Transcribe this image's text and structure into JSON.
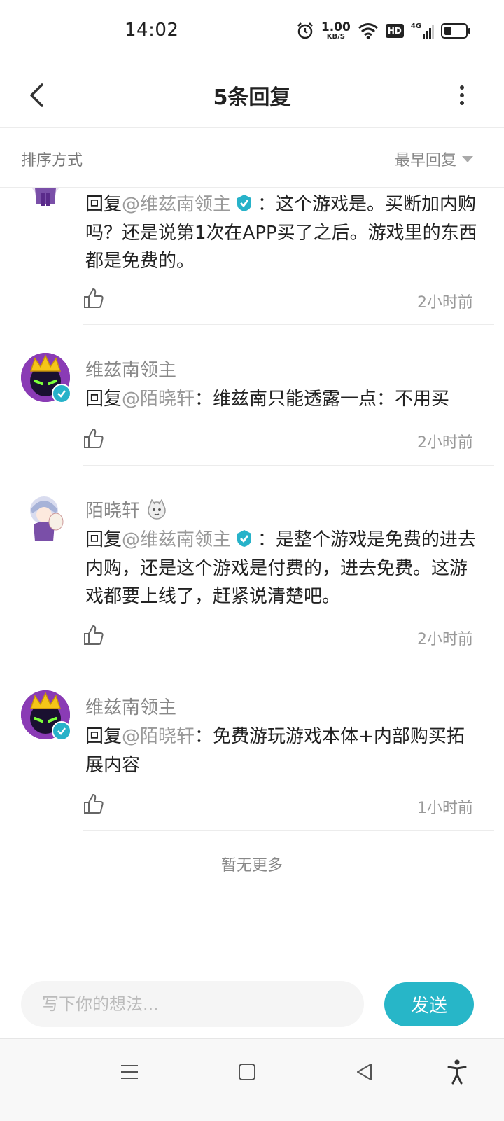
{
  "status_bar": {
    "time": "14:02",
    "net_speed_value": "1.00",
    "net_speed_unit": "KB/S",
    "hd_label": "HD",
    "signal_label": "4G",
    "battery_level": 0.35
  },
  "header": {
    "title": "5条回复"
  },
  "sort": {
    "label": "排序方式",
    "current": "最早回复"
  },
  "replies": [
    {
      "username": "",
      "prefix": "回复",
      "mention": "@维兹南领主",
      "mention_verified": true,
      "separator": "：",
      "text": "这个游戏是。买断加内购吗？还是说第1次在APP买了之后。游戏里的东西都是免费的。",
      "time": "2小时前"
    },
    {
      "username": "维兹南领主",
      "prefix": "回复",
      "mention": "@陌晓轩",
      "mention_verified": false,
      "separator": "：",
      "text": "维兹南只能透露一点：不用买",
      "time": "2小时前"
    },
    {
      "username": "陌晓轩",
      "prefix": "回复",
      "mention": "@维兹南领主",
      "mention_verified": true,
      "separator": "：",
      "text": "是整个游戏是免费的进去内购，还是这个游戏是付费的，进去免费。这游戏都要上线了，赶紧说清楚吧。",
      "time": "2小时前"
    },
    {
      "username": "维兹南领主",
      "prefix": "回复",
      "mention": "@陌晓轩",
      "mention_verified": false,
      "separator": "：",
      "text": "免费游玩游戏本体+内部购买拓展内容",
      "time": "1小时前"
    }
  ],
  "footer_note": "暂无更多",
  "composer": {
    "placeholder": "写下你的想法...",
    "send_label": "发送"
  },
  "colors": {
    "accent": "#27b6c8",
    "verified": "#27b2c9"
  }
}
